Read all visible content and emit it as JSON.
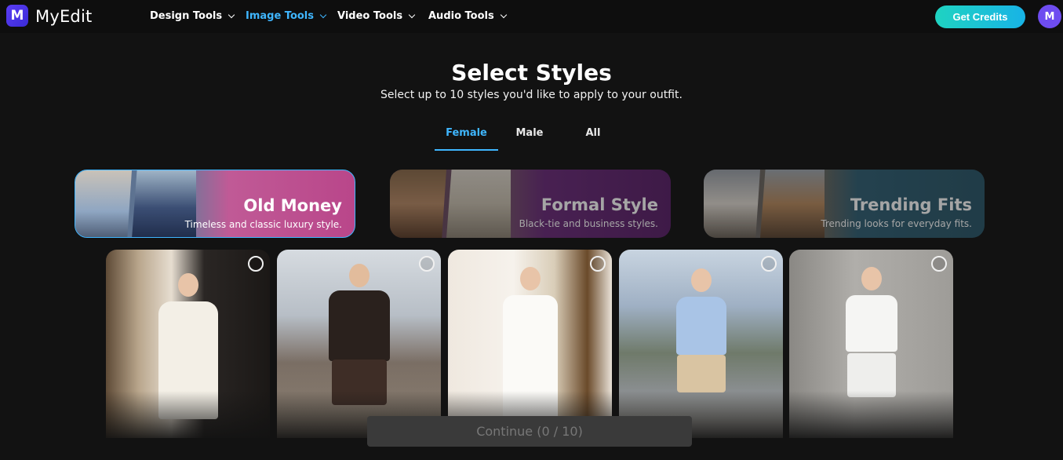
{
  "header": {
    "logo_letter": "M",
    "brand": "MyEdit",
    "nav": [
      {
        "label": "Design Tools",
        "active": false
      },
      {
        "label": "Image Tools",
        "active": true
      },
      {
        "label": "Video Tools",
        "active": false
      },
      {
        "label": "Audio Tools",
        "active": false
      }
    ],
    "get_credits": "Get Credits",
    "avatar_initial": "M"
  },
  "main": {
    "title": "Select Styles",
    "subtitle": "Select up to 10 styles you'd like to apply to your outfit.",
    "tabs": [
      {
        "label": "Female",
        "active": true
      },
      {
        "label": "Male",
        "active": false
      },
      {
        "label": "All",
        "active": false
      }
    ],
    "style_cards": [
      {
        "title": "Old Money",
        "subtitle": "Timeless and classic luxury style.",
        "selected": true
      },
      {
        "title": "Formal Style",
        "subtitle": "Black-tie and business styles.",
        "selected": false
      },
      {
        "title": "Trending Fits",
        "subtitle": "Trending looks for everyday fits.",
        "selected": false
      }
    ],
    "continue_label": "Continue (0 / 10)"
  },
  "colors": {
    "accent": "#3fb6ff",
    "background": "#121212",
    "credits_gradient_start": "#1fd3c1",
    "credits_gradient_end": "#18b3e6",
    "avatar": "#6e4cf0"
  }
}
